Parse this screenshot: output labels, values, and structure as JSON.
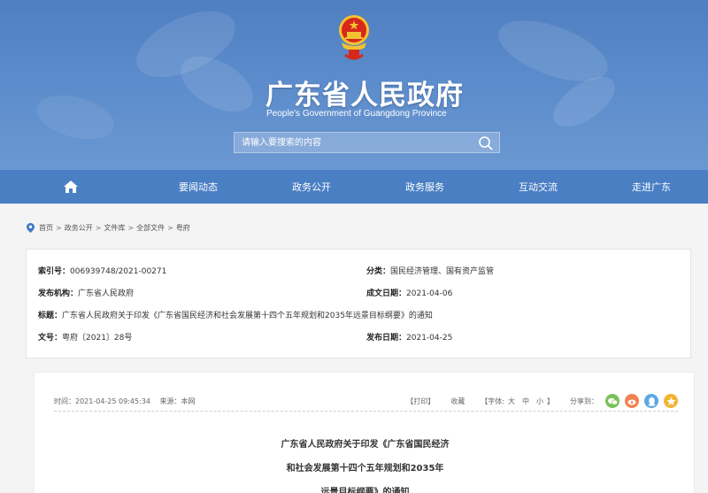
{
  "header": {
    "title": "广东省人民政府",
    "subtitle": "People's Government of Guangdong Province",
    "search_placeholder": "请输入要搜索的内容"
  },
  "nav": {
    "items": [
      "要闻动态",
      "政务公开",
      "政务服务",
      "互动交流",
      "走进广东"
    ]
  },
  "breadcrumb": [
    "首页",
    "政务公开",
    "文件库",
    "全部文件",
    "粤府"
  ],
  "info": {
    "index_label": "索引号：",
    "index_value": "006939748/2021-00271",
    "category_label": "分类：",
    "category_value": "国民经济管理、国有资产监管",
    "publisher_label": "发布机构：",
    "publisher_value": "广东省人民政府",
    "written_label": "成文日期：",
    "written_value": "2021-04-06",
    "title_label": "标题：",
    "title_value": "广东省人民政府关于印发《广东省国民经济和社会发展第十四个五年规划和2035年远景目标纲要》的通知",
    "docno_label": "文号：",
    "docno_value": "粤府〔2021〕28号",
    "published_label": "发布日期：",
    "published_value": "2021-04-25"
  },
  "article": {
    "time": "时间：2021-04-25 09:45:34",
    "source": "来源：本网",
    "print": "【打印】",
    "favorite": "收藏",
    "font_label": "【字体:",
    "font_large": "大",
    "font_medium": "中",
    "font_small": "小",
    "font_close": "】",
    "share_label": "分享到：",
    "title_lines": [
      "广东省人民政府关于印发《广东省国民经济",
      "和社会发展第十四个五年规划和2035年",
      "远景目标纲要》的通知"
    ]
  },
  "colors": {
    "header_blue": "#5b8bcb",
    "nav_blue": "#4a7fc4",
    "emblem_red": "#d7281c",
    "emblem_gold": "#f2c230"
  }
}
